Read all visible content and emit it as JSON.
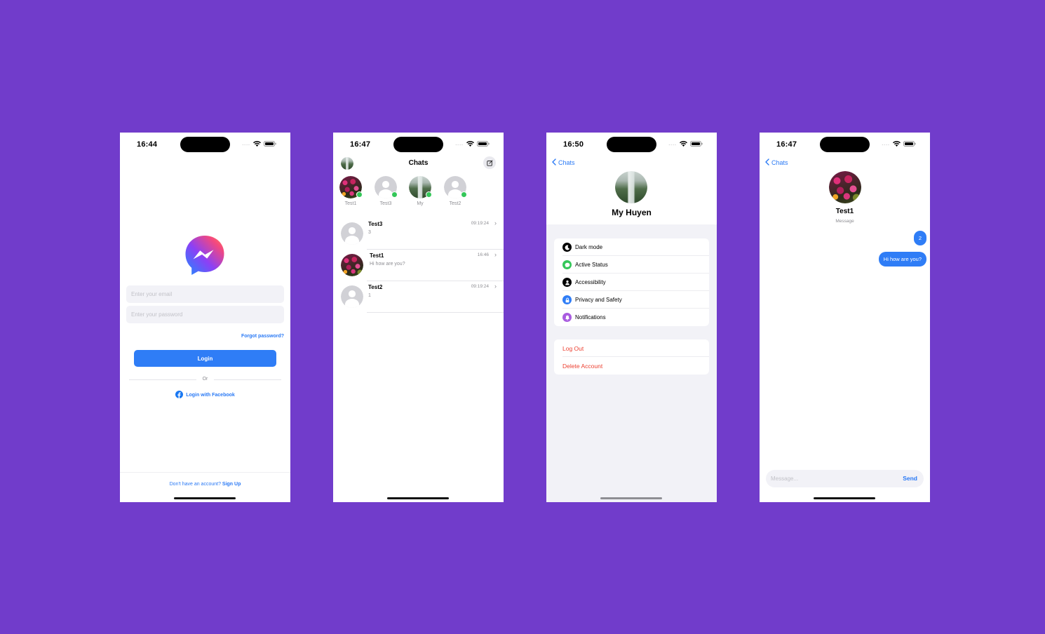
{
  "colors": {
    "background": "#713ccb",
    "accent": "#2f7df6",
    "danger": "#ec4132",
    "online": "#34c759"
  },
  "login_screen": {
    "time": "16:44",
    "email_placeholder": "Enter your email",
    "password_placeholder": "Enter your password",
    "forgot": "Forgot password?",
    "login_button": "Login",
    "or": "Or",
    "facebook_login": "Login with Facebook",
    "no_account": "Don't have an account?",
    "sign_up": "Sign Up"
  },
  "chats_screen": {
    "time": "16:47",
    "title": "Chats",
    "stories": [
      {
        "name": "Test1",
        "avatar": "flowers"
      },
      {
        "name": "Test3",
        "avatar": "placeholder"
      },
      {
        "name": "My",
        "avatar": "waterfall"
      },
      {
        "name": "Test2",
        "avatar": "placeholder"
      }
    ],
    "chats": [
      {
        "name": "Test3",
        "message": "3",
        "time": "09:19:24",
        "avatar": "placeholder"
      },
      {
        "name": "Test1",
        "message": "Hi how are you?",
        "time": "16:46",
        "avatar": "flowers"
      },
      {
        "name": "Test2",
        "message": "1",
        "time": "09:19:24",
        "avatar": "placeholder"
      }
    ]
  },
  "settings_screen": {
    "time": "16:50",
    "back": "Chats",
    "name": "My Huyen",
    "items": [
      {
        "label": "Dark mode",
        "icon": "moon-icon",
        "color": "#000000"
      },
      {
        "label": "Active Status",
        "icon": "chat-bubble-icon",
        "color": "#34c759"
      },
      {
        "label": "Accessibility",
        "icon": "person-icon",
        "color": "#000000"
      },
      {
        "label": "Privacy and Safety",
        "icon": "lock-icon",
        "color": "#2f7df6"
      },
      {
        "label": "Notifications",
        "icon": "bell-icon",
        "color": "#a95ce0"
      }
    ],
    "log_out": "Log Out",
    "delete_account": "Delete Account"
  },
  "conversation_screen": {
    "time": "16:47",
    "back": "Chats",
    "contact": "Test1",
    "subtitle": "Message",
    "messages": [
      "2",
      "Hi how are you?"
    ],
    "input_placeholder": "Message...",
    "send": "Send"
  }
}
